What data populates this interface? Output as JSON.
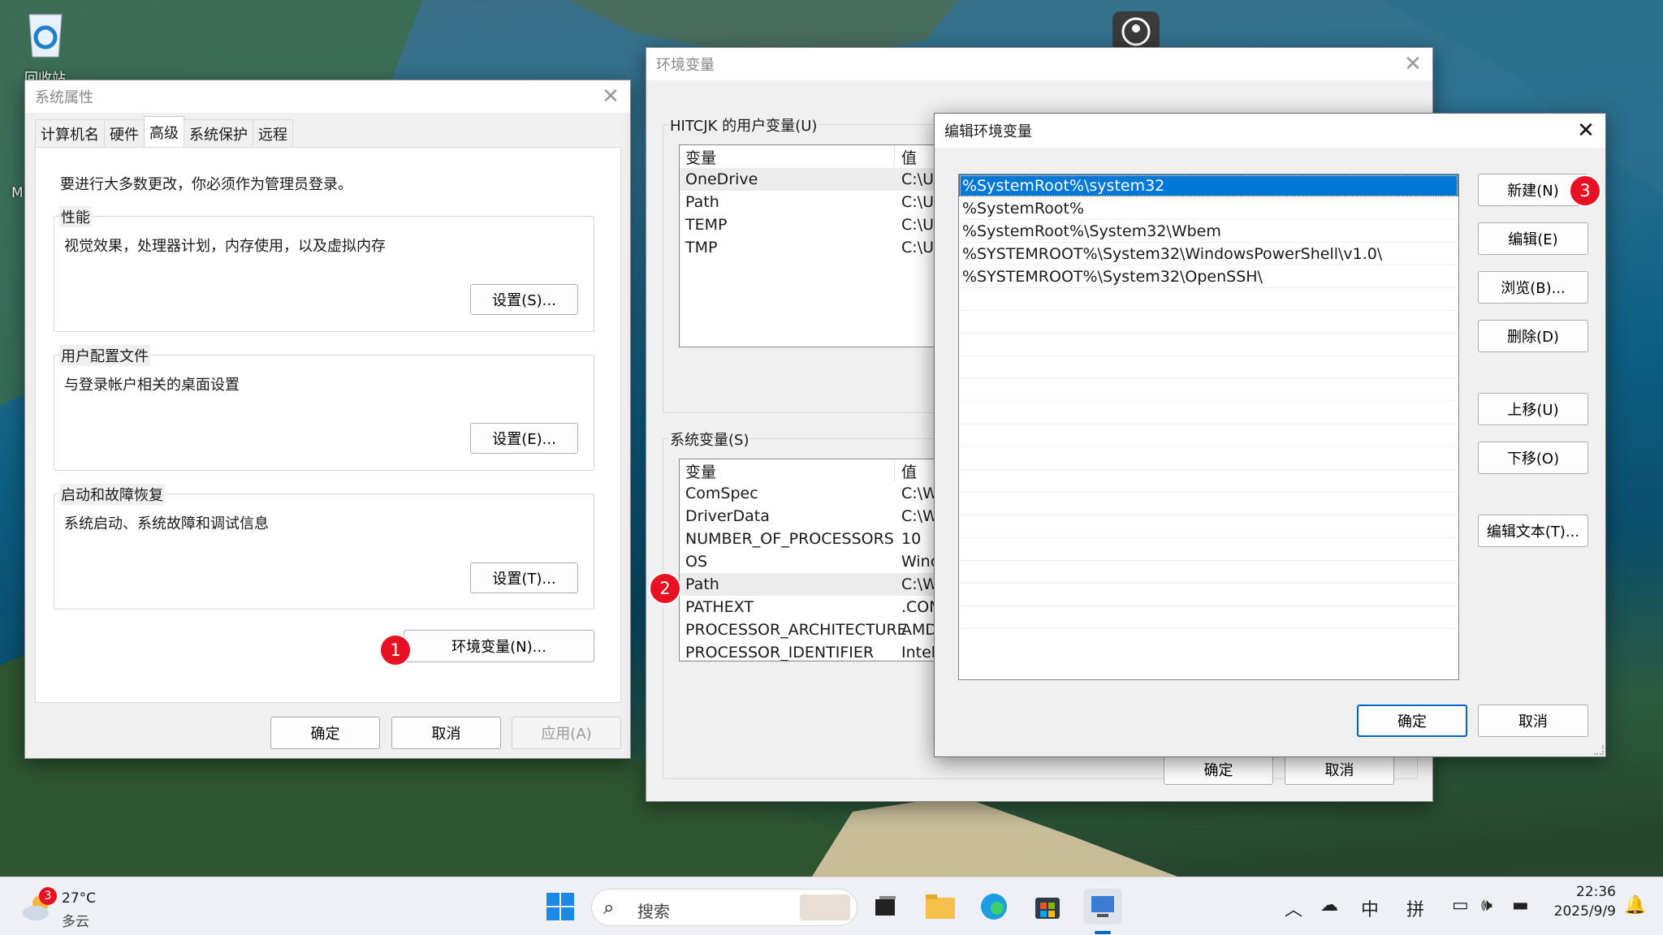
{
  "desktop": {
    "recycle_bin_label": "回收站",
    "desktop_char": "M"
  },
  "sysprops": {
    "title": "系统属性",
    "tabs": [
      "计算机名",
      "硬件",
      "高级",
      "系统保护",
      "远程"
    ],
    "admin_note": "要进行大多数更改，你必须作为管理员登录。",
    "perf": {
      "label": "性能",
      "desc": "视觉效果，处理器计划，内存使用，以及虚拟内存",
      "button": "设置(S)..."
    },
    "profile": {
      "label": "用户配置文件",
      "desc": "与登录帐户相关的桌面设置",
      "button": "设置(E)..."
    },
    "startup": {
      "label": "启动和故障恢复",
      "desc": "系统启动、系统故障和调试信息",
      "button": "设置(T)..."
    },
    "env_button": "环境变量(N)...",
    "ok": "确定",
    "cancel": "取消",
    "apply": "应用(A)"
  },
  "envvars": {
    "title": "环境变量",
    "user_label": "HITCJK 的用户变量(U)",
    "sys_label": "系统变量(S)",
    "col_var": "变量",
    "col_val": "值",
    "user_rows": [
      {
        "name": "OneDrive",
        "value": "C:\\Us"
      },
      {
        "name": "Path",
        "value": "C:\\Us"
      },
      {
        "name": "TEMP",
        "value": "C:\\Us"
      },
      {
        "name": "TMP",
        "value": "C:\\Us"
      }
    ],
    "sys_rows": [
      {
        "name": "ComSpec",
        "value": "C:\\W"
      },
      {
        "name": "DriverData",
        "value": "C:\\W"
      },
      {
        "name": "NUMBER_OF_PROCESSORS",
        "value": "10"
      },
      {
        "name": "OS",
        "value": "Winc"
      },
      {
        "name": "Path",
        "value": "C:\\W"
      },
      {
        "name": "PATHEXT",
        "value": ".COM"
      },
      {
        "name": "PROCESSOR_ARCHITECTURE",
        "value": "AMD"
      },
      {
        "name": "PROCESSOR_IDENTIFIER",
        "value": "Intel("
      }
    ],
    "ok": "确定",
    "cancel": "取消"
  },
  "editenv": {
    "title": "编辑环境变量",
    "entries": [
      "%SystemRoot%\\system32",
      "%SystemRoot%",
      "%SystemRoot%\\System32\\Wbem",
      "%SYSTEMROOT%\\System32\\WindowsPowerShell\\v1.0\\",
      "%SYSTEMROOT%\\System32\\OpenSSH\\"
    ],
    "buttons": {
      "new": "新建(N)",
      "edit": "编辑(E)",
      "browse": "浏览(B)...",
      "delete": "删除(D)",
      "up": "上移(U)",
      "down": "下移(O)",
      "edit_text": "编辑文本(T)..."
    },
    "ok": "确定",
    "cancel": "取消"
  },
  "badges": [
    "1",
    "2",
    "3"
  ],
  "taskbar": {
    "weather_temp": "27°C",
    "weather_desc": "多云",
    "weather_badge": "3",
    "search_placeholder": "搜索",
    "ime_lang": "中",
    "ime_mode": "拼",
    "time": "22:36",
    "date": "2025/9/9"
  },
  "colors": {
    "accent": "#0078d7",
    "badge": "#e81123"
  }
}
